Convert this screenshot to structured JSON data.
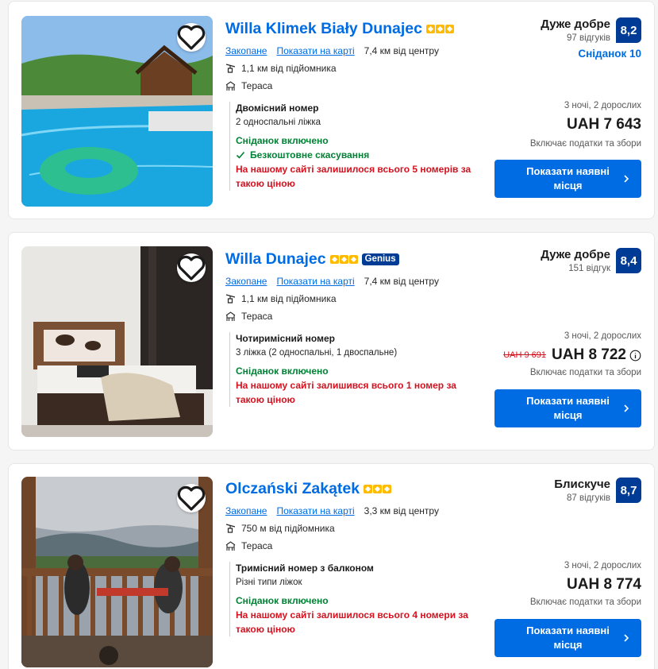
{
  "hotels": [
    {
      "name": "Willa Klimek Biały Dunajec",
      "stars": 3,
      "genius": "",
      "location": {
        "town": "Закопане",
        "map_link": "Показати на карті",
        "distance": "7,4 км від центру"
      },
      "ski_lift": "1,1 км від підйомника",
      "amenity": "Тераса",
      "room": {
        "name": "Двомісний номер",
        "beds": "2 односпальні ліжка",
        "breakfast": "Сніданок включено",
        "cancellation": "Безкоштовне скасування",
        "scarcity": "На нашому сайті залишилося всього 5 номерів за такою ціною"
      },
      "review": {
        "word": "Дуже добре",
        "count": "97 відгуків",
        "score": "8,2",
        "subscore": "Сніданок 10"
      },
      "nights": "3 ночі, 2 дорослих",
      "old_price": "",
      "price": "UAH 7 643",
      "taxes": "Включає податки та збори",
      "button": "Показати наявні місця"
    },
    {
      "name": "Willa Dunajec",
      "stars": 3,
      "genius": "Genius",
      "location": {
        "town": "Закопане",
        "map_link": "Показати на карті",
        "distance": "7,4 км від центру"
      },
      "ski_lift": "1,1 км від підйомника",
      "amenity": "Тераса",
      "room": {
        "name": "Чотиримісний номер",
        "beds": "3 ліжка (2 односпальні, 1 двоспальне)",
        "breakfast": "Сніданок включено",
        "cancellation": "",
        "scarcity": "На нашому сайті залишився всього 1 номер за такою ціною"
      },
      "review": {
        "word": "Дуже добре",
        "count": "151 відгук",
        "score": "8,4",
        "subscore": ""
      },
      "nights": "3 ночі, 2 дорослих",
      "old_price": "UAH 9 691",
      "price": "UAH 8 722",
      "taxes": "Включає податки та збори",
      "button": "Показати наявні місця"
    },
    {
      "name": "Olczański Zakątek",
      "stars": 3,
      "genius": "",
      "location": {
        "town": "Закопане",
        "map_link": "Показати на карті",
        "distance": "3,3 км від центру"
      },
      "ski_lift": "750 м від підйомника",
      "amenity": "Тераса",
      "room": {
        "name": "Тримісний номер з балконом",
        "beds": "Різні типи ліжок",
        "breakfast": "Сніданок включено",
        "cancellation": "",
        "scarcity": "На нашому сайті залишилося всього 4 номери за такою ціною"
      },
      "review": {
        "word": "Блискуче",
        "count": "87 відгуків",
        "score": "8,7",
        "subscore": ""
      },
      "nights": "3 ночі, 2 дорослих",
      "old_price": "",
      "price": "UAH 8 774",
      "taxes": "Включає податки та збори",
      "button": "Показати наявні місця"
    }
  ],
  "colors": {
    "brand_blue": "#006ce4",
    "score_blue": "#003b95",
    "green": "#008234",
    "red": "#d4111e",
    "star": "#febb02"
  },
  "icons": [
    "heart-icon",
    "ski-lift-icon",
    "terrace-icon",
    "check-icon",
    "chevron-right-icon",
    "info-icon"
  ]
}
